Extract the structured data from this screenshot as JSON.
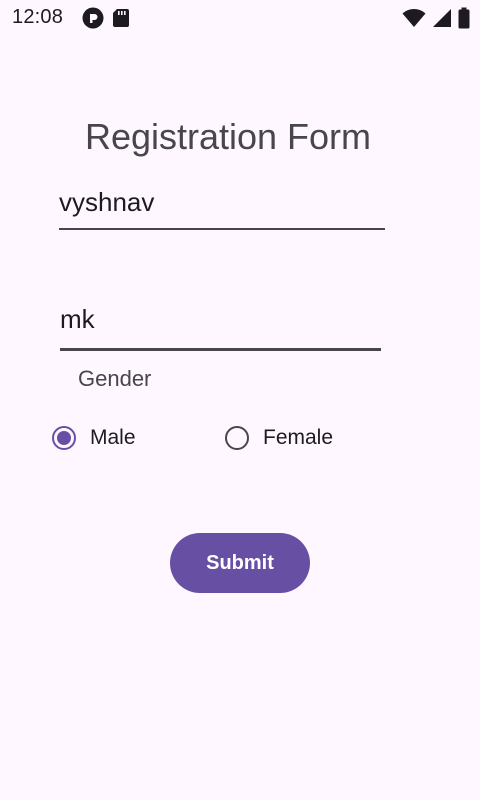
{
  "status_bar": {
    "time": "12:08",
    "left_icons": [
      "pocket-casts-icon",
      "sd-card-icon"
    ],
    "right_icons": [
      "wifi-icon",
      "cell-signal-icon",
      "battery-icon"
    ]
  },
  "form": {
    "title": "Registration Form",
    "first_name_value": "vyshnav",
    "last_name_value": "mk",
    "gender_label": "Gender",
    "gender_options": [
      {
        "label": "Male",
        "checked": true
      },
      {
        "label": "Female",
        "checked": false
      }
    ],
    "submit_label": "Submit"
  },
  "colors": {
    "background": "#FEF7FF",
    "primary": "#6750A4",
    "on_surface": "#1D1B20",
    "outline": "#49454F"
  }
}
